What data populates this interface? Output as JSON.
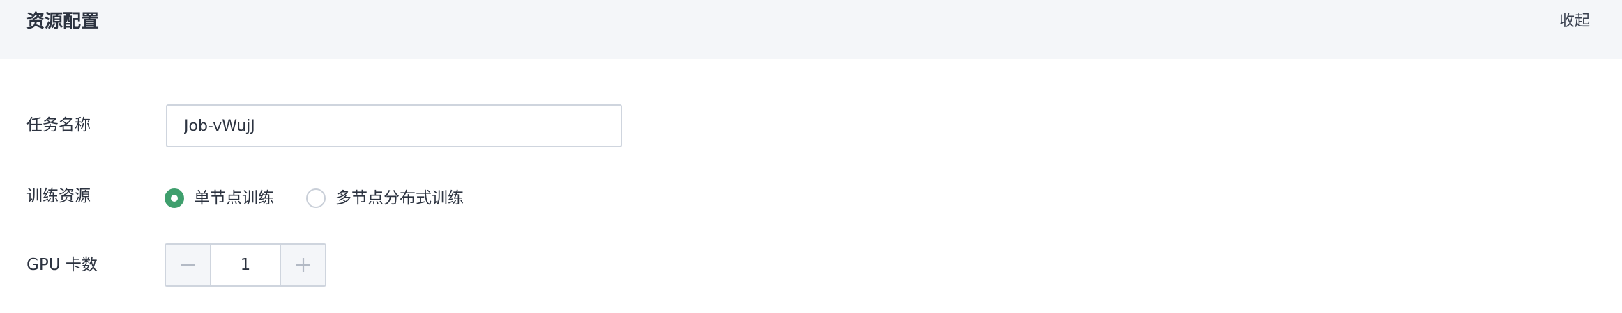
{
  "section": {
    "title": "资源配置",
    "collapse_label": "收起"
  },
  "form": {
    "task_name": {
      "label": "任务名称",
      "value": "Job-vWujJ"
    },
    "training_resource": {
      "label": "训练资源",
      "options": [
        {
          "label": "单节点训练",
          "selected": true
        },
        {
          "label": "多节点分布式训练",
          "selected": false
        }
      ]
    },
    "gpu_count": {
      "label": "GPU 卡数",
      "value": "1",
      "decrement_icon": "minus-icon",
      "increment_icon": "plus-icon"
    }
  },
  "colors": {
    "accent": "#3f9f6d",
    "header_bg": "#f4f6f9",
    "border": "#cfd5de"
  }
}
